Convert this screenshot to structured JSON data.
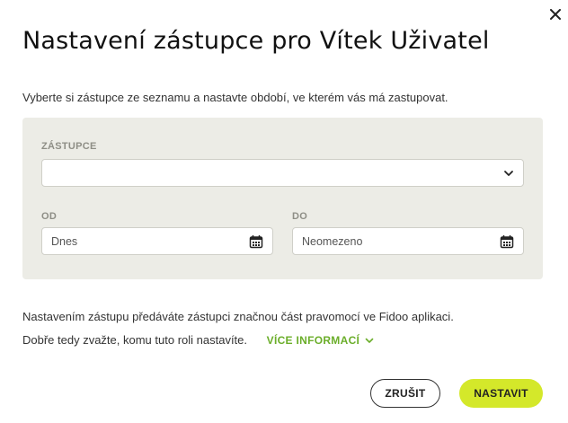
{
  "dialog": {
    "title": "Nastavení zástupce pro Vítek Uživatel",
    "intro": "Vyberte si zástupce ze seznamu a nastavte období, ve kterém vás má zastupovat.",
    "close_icon": "close-icon"
  },
  "form": {
    "substitute_label": "ZÁSTUPCE",
    "substitute_value": "",
    "from_label": "OD",
    "from_placeholder": "Dnes",
    "to_label": "DO",
    "to_placeholder": "Neomezeno"
  },
  "note": {
    "line1": "Nastavením zástupu předáváte zástupci značnou část pravomocí ve Fidoo aplikaci.",
    "line2": "Dobře tedy zvažte, komu tuto roli nastavíte.",
    "more_link": "VÍCE INFORMACÍ"
  },
  "actions": {
    "cancel_label": "ZRUŠIT",
    "submit_label": "NASTAVIT"
  },
  "colors": {
    "accent": "#d4e82a",
    "link": "#6bae2a",
    "panel_bg": "#ecece6"
  }
}
